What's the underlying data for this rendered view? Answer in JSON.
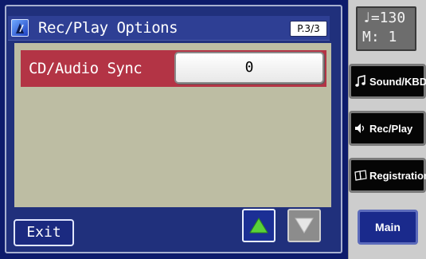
{
  "header": {
    "title": "Rec/Play Options",
    "page_indicator": "P.3/3"
  },
  "settings": {
    "rows": [
      {
        "label": "CD/Audio Sync",
        "value": "0"
      }
    ]
  },
  "footer": {
    "exit_label": "Exit"
  },
  "tempo_display": {
    "tempo_symbol": "♩=130",
    "measure": "M:   1"
  },
  "side_buttons": {
    "sound_kbd": "Sound/KBD",
    "rec_play": "Rec/Play",
    "registration": "Registration",
    "main": "Main"
  },
  "colors": {
    "screen_bg": "#20307c",
    "content_bg": "#bdbda3",
    "row_highlight": "#b33445",
    "up_arrow": "#5ad13a",
    "down_arrow_disabled": "#8c8c8c"
  },
  "icons": {
    "app": "metronome-icon",
    "up": "up-arrow-icon",
    "down": "down-arrow-icon",
    "sound": "music-note-icon",
    "rec": "speaker-icon",
    "registration": "book-icon"
  }
}
